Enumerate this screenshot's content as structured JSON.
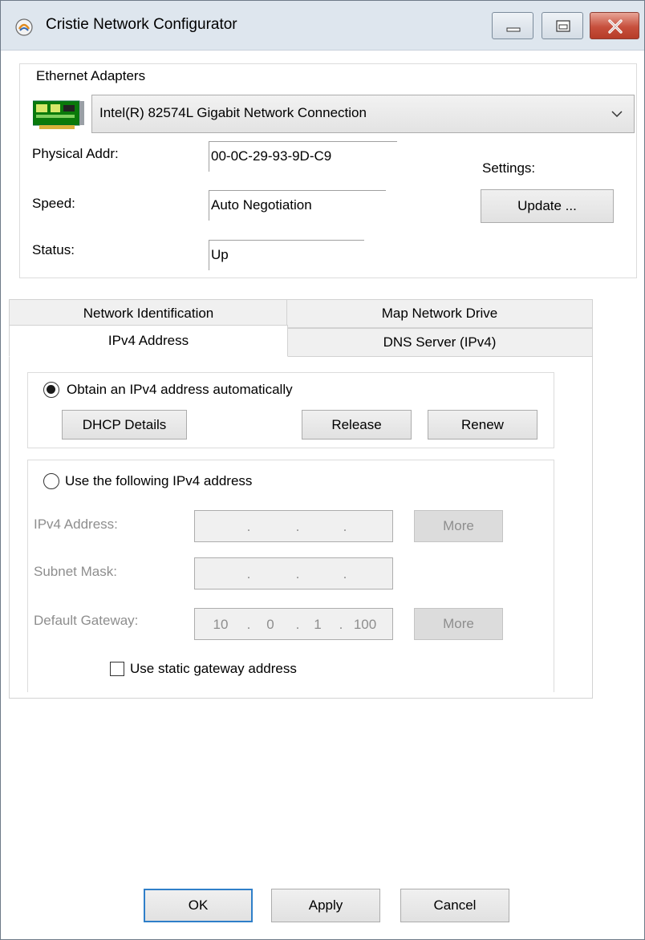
{
  "window": {
    "title": "Cristie Network Configurator"
  },
  "adapters": {
    "group_label": "Ethernet Adapters",
    "selected": "Intel(R) 82574L Gigabit Network Connection",
    "physical_addr_label": "Physical Addr:",
    "physical_addr": "00-0C-29-93-9D-C9",
    "speed_label": "Speed:",
    "speed": "Auto Negotiation",
    "status_label": "Status:",
    "status": "Up",
    "settings_label": "Settings:",
    "update_button": "Update ..."
  },
  "tabs": {
    "network_identification": "Network Identification",
    "map_network_drive": "Map Network Drive",
    "ipv4_address": "IPv4 Address",
    "dns_server": "DNS Server (IPv4)",
    "active": "IPv4 Address"
  },
  "ipv4": {
    "auto_radio_label": "Obtain an IPv4 address automatically",
    "auto_selected": true,
    "dhcp_details_button": "DHCP Details",
    "release_button": "Release",
    "renew_button": "Renew",
    "static_radio_label": "Use the following IPv4 address",
    "ipv4_address_label": "IPv4 Address:",
    "ipv4_address_octets": [
      "",
      "",
      "",
      ""
    ],
    "subnet_mask_label": "Subnet Mask:",
    "subnet_mask_octets": [
      "",
      "",
      "",
      ""
    ],
    "default_gateway_label": "Default Gateway:",
    "default_gateway_octets": [
      "10",
      "0",
      "1",
      "100"
    ],
    "more_button": "More",
    "static_gateway_checkbox_label": "Use static gateway address",
    "static_gateway_checked": false
  },
  "footer": {
    "ok_button": "OK",
    "apply_button": "Apply",
    "cancel_button": "Cancel"
  },
  "icons": {
    "app": "cristie-logo-icon",
    "adapter": "network-card-icon",
    "minimize": "minimize-icon",
    "maximize": "maximize-icon",
    "close": "close-icon",
    "dropdown": "chevron-down-icon"
  },
  "colors": {
    "title_bar": "#dee6ee",
    "close_button": "#c7503d",
    "default_button_border": "#2f7fc9",
    "disabled_text": "#8e8e8e"
  }
}
